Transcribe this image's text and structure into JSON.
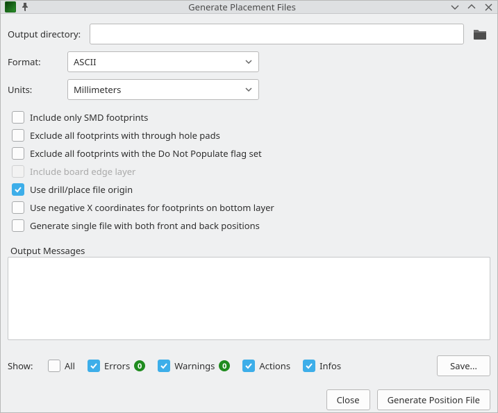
{
  "window": {
    "title": "Generate Placement Files"
  },
  "form": {
    "output_directory_label": "Output directory:",
    "output_directory_value": "",
    "format_label": "Format:",
    "format_value": "ASCII",
    "units_label": "Units:",
    "units_value": "Millimeters"
  },
  "checks": {
    "only_smd": {
      "label": "Include only SMD footprints",
      "checked": false,
      "disabled": false
    },
    "exclude_tht": {
      "label": "Exclude all footprints with through hole pads",
      "checked": false,
      "disabled": false
    },
    "exclude_dnp": {
      "label": "Exclude all footprints with the Do Not Populate flag set",
      "checked": false,
      "disabled": false
    },
    "board_edge": {
      "label": "Include board edge layer",
      "checked": false,
      "disabled": true
    },
    "drill_origin": {
      "label": "Use drill/place file origin",
      "checked": true,
      "disabled": false
    },
    "neg_x_bottom": {
      "label": "Use negative X coordinates for footprints on bottom layer",
      "checked": false,
      "disabled": false
    },
    "single_file": {
      "label": "Generate single file with both front and back positions",
      "checked": false,
      "disabled": false
    }
  },
  "output_messages": {
    "title": "Output Messages"
  },
  "filters": {
    "show_label": "Show:",
    "all": {
      "label": "All",
      "checked": false
    },
    "errors": {
      "label": "Errors",
      "checked": true,
      "count": "0"
    },
    "warnings": {
      "label": "Warnings",
      "checked": true,
      "count": "0"
    },
    "actions": {
      "label": "Actions",
      "checked": true
    },
    "infos": {
      "label": "Infos",
      "checked": true
    },
    "save_label": "Save..."
  },
  "buttons": {
    "close": "Close",
    "generate": "Generate Position File"
  }
}
